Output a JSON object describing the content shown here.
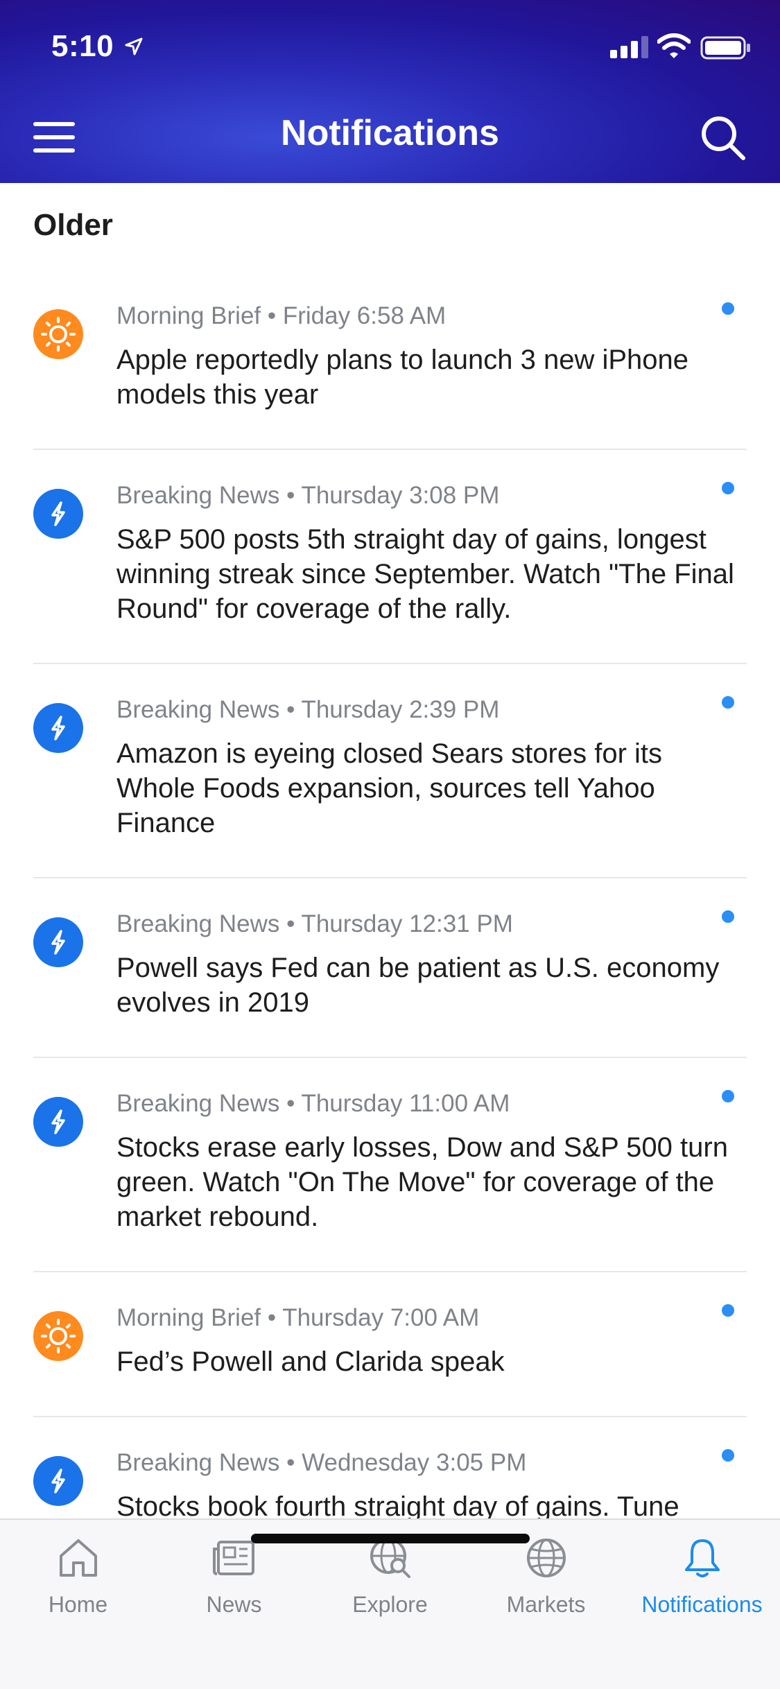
{
  "status_bar": {
    "time": "5:10"
  },
  "header": {
    "title": "Notifications"
  },
  "section": {
    "title": "Older"
  },
  "notifications": [
    {
      "type": "brief",
      "icon": "sun-icon",
      "meta": "Morning Brief • Friday 6:58 AM",
      "headline": "Apple reportedly plans to launch 3 new iPhone models this year",
      "unread": true
    },
    {
      "type": "breaking",
      "icon": "lightning-icon",
      "meta": "Breaking News • Thursday 3:08 PM",
      "headline": "S&P 500 posts 5th straight day of gains, longest winning streak since September. Watch \"The Final Round\" for coverage of the rally.",
      "unread": true
    },
    {
      "type": "breaking",
      "icon": "lightning-icon",
      "meta": "Breaking News • Thursday 2:39 PM",
      "headline": "Amazon is eyeing closed Sears stores for its Whole Foods expansion, sources tell Yahoo Finance",
      "unread": true
    },
    {
      "type": "breaking",
      "icon": "lightning-icon",
      "meta": "Breaking News • Thursday 12:31 PM",
      "headline": "Powell says Fed can be patient as U.S. economy evolves in 2019",
      "unread": true
    },
    {
      "type": "breaking",
      "icon": "lightning-icon",
      "meta": "Breaking News • Thursday 11:00 AM",
      "headline": "Stocks erase early losses, Dow and S&P 500 turn green. Watch \"On The Move\" for coverage of the market rebound.",
      "unread": true
    },
    {
      "type": "brief",
      "icon": "sun-icon",
      "meta": "Morning Brief • Thursday 7:00 AM",
      "headline": "Fed’s Powell and Clarida speak",
      "unread": true
    },
    {
      "type": "breaking",
      "icon": "lightning-icon",
      "meta": "Breaking News • Wednesday 3:05 PM",
      "headline": "Stocks book fourth straight day of gains. Tune",
      "unread": true
    }
  ],
  "tab_bar": {
    "tabs": [
      {
        "label": "Home",
        "icon": "home-icon",
        "active": false
      },
      {
        "label": "News",
        "icon": "news-icon",
        "active": false
      },
      {
        "label": "Explore",
        "icon": "explore-icon",
        "active": false
      },
      {
        "label": "Markets",
        "icon": "globe-icon",
        "active": false
      },
      {
        "label": "Notifications",
        "icon": "bell-icon",
        "active": true
      }
    ]
  },
  "colors": {
    "header_gradient_start": "#3a4bd6",
    "header_gradient_end": "#2a0a7a",
    "brief_icon": "#ff8a1e",
    "breaking_icon": "#1a73e8",
    "unread_dot": "#2a8ef5",
    "active_tab": "#1a8cf0",
    "meta_text": "#7f8389"
  }
}
